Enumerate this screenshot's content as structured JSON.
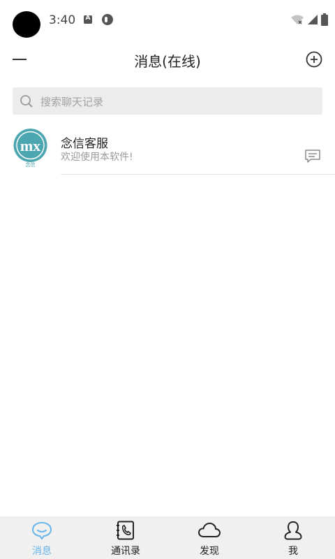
{
  "status_bar": {
    "time": "3:40"
  },
  "header": {
    "title": "消息(在线)"
  },
  "search": {
    "placeholder": "搜索聊天记录"
  },
  "conversations": [
    {
      "name": "念信客服",
      "preview": "欢迎使用本软件!",
      "avatar_text": "念信",
      "avatar_color": "#4ca6b0"
    }
  ],
  "tabs": [
    {
      "label": "消息",
      "icon": "chat-bubble-icon",
      "active": true
    },
    {
      "label": "通讯录",
      "icon": "contacts-book-icon",
      "active": false
    },
    {
      "label": "发现",
      "icon": "cloud-icon",
      "active": false
    },
    {
      "label": "我",
      "icon": "person-icon",
      "active": false
    }
  ],
  "colors": {
    "accent": "#68b5ea",
    "tab_bar_bg": "#f0f0f0",
    "search_bg": "#ececec"
  }
}
